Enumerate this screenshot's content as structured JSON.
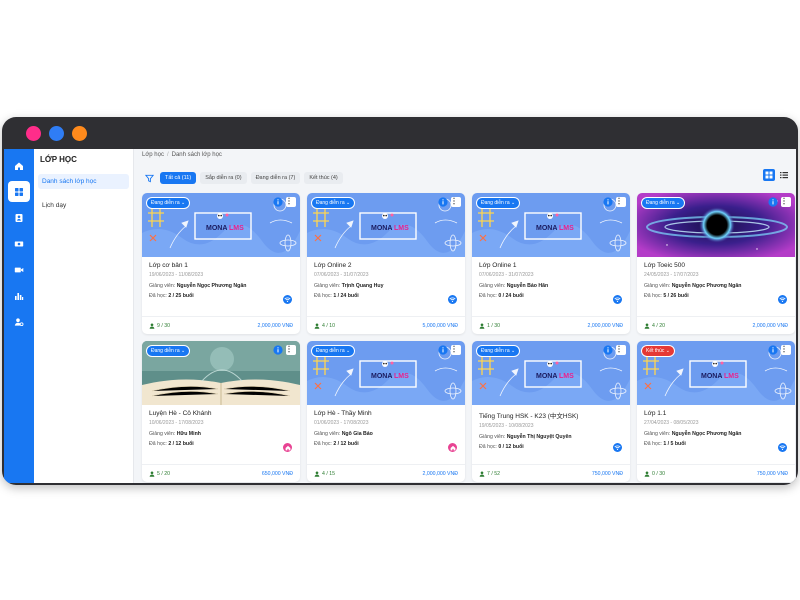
{
  "colors": {
    "accent": "#1877f2",
    "dot_pink": "#ff2d8a",
    "dot_blue": "#2f7df5",
    "dot_orange": "#ff8a1c",
    "ended": "#e53935",
    "student": "#2e7d32"
  },
  "window": {
    "dots": [
      "pink-dot",
      "blue-dot",
      "orange-dot"
    ]
  },
  "rail": {
    "icons": [
      "home-icon",
      "dashboard-icon",
      "student-icon",
      "money-icon",
      "video-icon",
      "chart-icon",
      "user-settings-icon"
    ],
    "active": 1
  },
  "sidenav": {
    "title": "LỚP HỌC",
    "items": [
      {
        "label": "Danh sách lớp học",
        "active": true
      },
      {
        "label": "Lịch dạy",
        "active": false
      }
    ]
  },
  "breadcrumb": {
    "items": [
      "Lớp học",
      "Danh sách lớp học"
    ],
    "sep": "/"
  },
  "filters": {
    "tabs": [
      {
        "label": "Tất cả (11)",
        "active": true
      },
      {
        "label": "Sắp diễn ra (0)"
      },
      {
        "label": "Đang diễn ra (7)"
      },
      {
        "label": "Kết thúc (4)"
      }
    ]
  },
  "view_toggle": {
    "icons": [
      "grid-view-icon",
      "list-view-icon"
    ],
    "active": "grid"
  },
  "labels": {
    "teacher": "Giảng viên: ",
    "progress": "Đã học: "
  },
  "classes": [
    {
      "status": "Đang diễn ra",
      "status_type": "ongoing",
      "thumb": "mona",
      "name": "Lớp cơ bản 1",
      "dates": "19/06/2023 - 11/08/2023",
      "teacher": "Nguyễn Ngọc Phương Ngân",
      "progress": "2 / 25 buổi",
      "students": "9 / 30",
      "price": "2,000,000 VNĐ",
      "icon": "wifi-icon"
    },
    {
      "status": "Đang diễn ra",
      "status_type": "ongoing",
      "thumb": "mona",
      "name": "Lớp Online 2",
      "dates": "07/06/2023 - 31/07/2023",
      "teacher": "Trịnh Quang Huy",
      "progress": "1 / 24 buổi",
      "students": "4 / 10",
      "price": "5,000,000 VNĐ",
      "icon": "wifi-icon"
    },
    {
      "status": "Đang diễn ra",
      "status_type": "ongoing",
      "thumb": "mona",
      "name": "Lớp Online 1",
      "dates": "07/06/2023 - 31/07/2023",
      "teacher": "Nguyễn Bảo Hân",
      "progress": "0 / 24 buổi",
      "students": "1 / 30",
      "price": "2,000,000 VNĐ",
      "icon": "wifi-icon"
    },
    {
      "status": "Đang diễn ra",
      "status_type": "ongoing",
      "thumb": "space",
      "name": "Lớp Toeic 500",
      "dates": "24/05/2023 - 17/07/2023",
      "teacher": "Nguyễn Ngọc Phương Ngân",
      "progress": "5 / 26 buổi",
      "students": "4 / 20",
      "price": "2,000,000 VNĐ",
      "icon": "wifi-icon"
    },
    {
      "status": "Đang diễn ra",
      "status_type": "ongoing",
      "thumb": "book",
      "name": "Luyện Hè - Cô Khánh",
      "dates": "10/06/2023 - 17/08/2023",
      "teacher": "Hữu Minh",
      "progress": "2 / 12 buổi",
      "students": "5 / 20",
      "price": "650,000 VNĐ",
      "icon": "home-icon"
    },
    {
      "status": "Đang diễn ra",
      "status_type": "ongoing",
      "thumb": "mona",
      "name": "Lớp Hè - Thầy Minh",
      "dates": "01/06/2023 - 17/08/2023",
      "teacher": "Ngô Gia Bảo",
      "progress": "2 / 12 buổi",
      "students": "4 / 15",
      "price": "2,000,000 VNĐ",
      "icon": "home-icon"
    },
    {
      "status": "Đang diễn ra",
      "status_type": "ongoing",
      "thumb": "mona",
      "name": "Tiếng Trung HSK - K23 (中文HSK)",
      "dates": "19/05/2023 - 10/08/2023",
      "teacher": "Nguyễn Thị Nguyệt Quyên",
      "progress": "0 / 12 buổi",
      "students": "7 / 52",
      "price": "750,000 VNĐ",
      "icon": "wifi-icon"
    },
    {
      "status": "Kết thúc",
      "status_type": "ended",
      "thumb": "mona",
      "name": "Lớp 1.1",
      "dates": "27/04/2023 - 08/05/2023",
      "teacher": "Nguyễn Ngọc Phương Ngân",
      "progress": "1 / 5 buổi",
      "students": "0 / 30",
      "price": "750,000 VNĐ",
      "icon": "wifi-icon"
    }
  ],
  "logo": {
    "text_a": "MONA",
    "text_b": "LMS"
  }
}
